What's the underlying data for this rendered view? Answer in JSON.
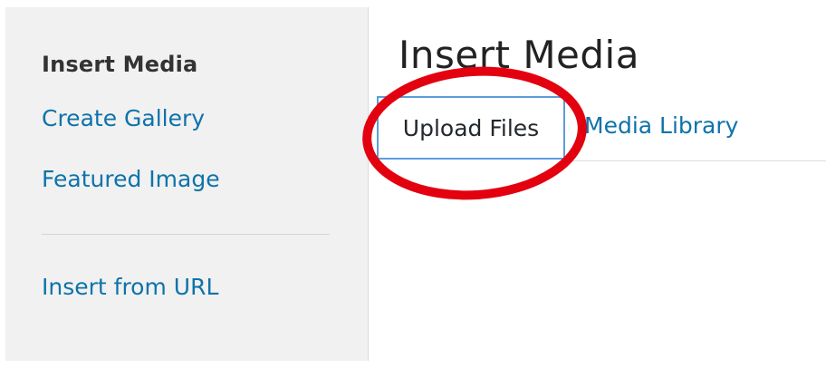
{
  "sidebar": {
    "heading": "Insert Media",
    "links": [
      {
        "label": "Create Gallery"
      },
      {
        "label": "Featured Image"
      },
      {
        "label": "Insert from URL"
      }
    ]
  },
  "main": {
    "title": "Insert Media",
    "tabs": [
      {
        "label": "Upload Files",
        "active": true
      },
      {
        "label": "Media Library",
        "active": false
      }
    ]
  },
  "annotation": {
    "type": "highlight-ellipse",
    "color": "#e3000f"
  },
  "colors": {
    "link": "#0e73aa",
    "sidebar_bg": "#f1f1f1",
    "active_tab_border": "#5b9dd9",
    "annotation": "#e3000f"
  }
}
